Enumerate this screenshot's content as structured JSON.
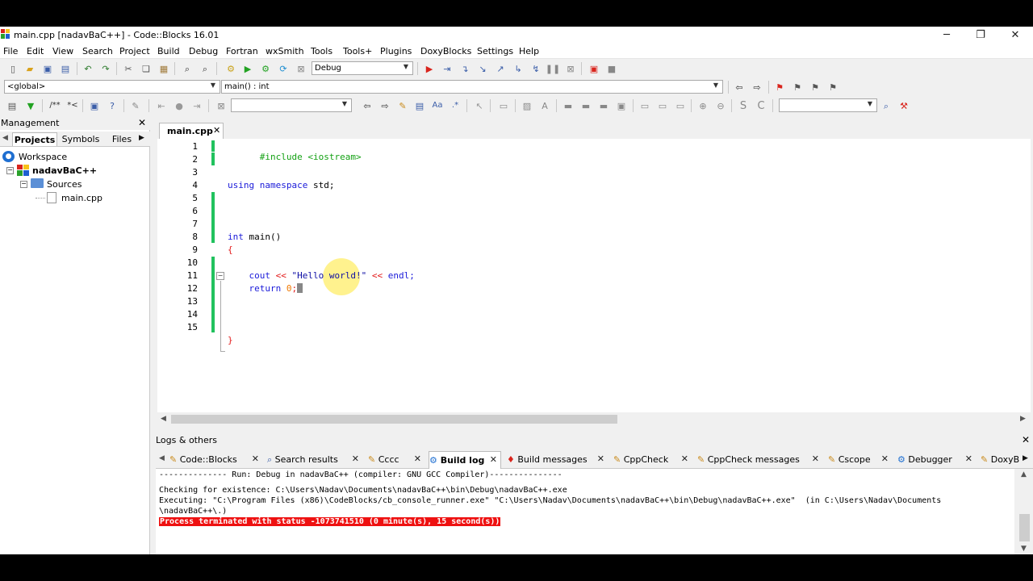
{
  "window": {
    "title": "main.cpp [nadavBaC++] - Code::Blocks 16.01",
    "minimize_glyph": "─",
    "restore_glyph": "❐",
    "close_glyph": "✕"
  },
  "menu": [
    "File",
    "Edit",
    "View",
    "Search",
    "Project",
    "Build",
    "Debug",
    "Fortran",
    "wxSmith",
    "Tools",
    "Tools+",
    "Plugins",
    "DoxyBlocks",
    "Settings",
    "Help"
  ],
  "toolbar": {
    "build_target": "Debug",
    "scope": "<global>",
    "function": "main() : int",
    "search_value": "",
    "find_value": ""
  },
  "management": {
    "title": "Management",
    "tabs": [
      "Projects",
      "Symbols",
      "Files"
    ],
    "active_tab": "Projects",
    "tree": {
      "workspace": "Workspace",
      "project": "nadavBaC++",
      "folder": "Sources",
      "file": "main.cpp"
    }
  },
  "editor": {
    "tab_label": "main.cpp",
    "line_numbers": [
      "1",
      "2",
      "3",
      "4",
      "5",
      "6",
      "7",
      "8",
      "9",
      "10",
      "11",
      "12",
      "13",
      "14",
      "15"
    ],
    "lines": {
      "l1": "#include <iostream>",
      "l4_kw": "using namespace",
      "l4_rest": " std;",
      "l8_kw": "int",
      "l8_rest": " main()",
      "l9": "{",
      "l11_a": "    cout ",
      "l11_op1": "<<",
      "l11_str": " \"Hello world!\" ",
      "l11_op2": "<<",
      "l11_b": " endl;",
      "l12_kw": "    return",
      "l12_num": " 0",
      "l12_b": ";",
      "l14": "}"
    }
  },
  "logs": {
    "title": "Logs & others",
    "tabs": [
      "Code::Blocks",
      "Search results",
      "Cccc",
      "Build log",
      "Build messages",
      "CppCheck",
      "CppCheck messages",
      "Cscope",
      "Debugger",
      "DoxyB"
    ],
    "active_tab": "Build log",
    "lines": [
      "-------------- Run: Debug in nadavBaC++ (compiler: GNU GCC Compiler)---------------",
      "Checking for existence: C:\\Users\\Nadav\\Documents\\nadavBaC++\\bin\\Debug\\nadavBaC++.exe",
      "Executing: \"C:\\Program Files (x86)\\CodeBlocks/cb_console_runner.exe\" \"C:\\Users\\Nadav\\Documents\\nadavBaC++\\bin\\Debug\\nadavBaC++.exe\"  (in C:\\Users\\Nadav\\Documents",
      "\\nadavBaC++\\.)"
    ],
    "status_line": "Process terminated with status -1073741510 (0 minute(s), 15 second(s))"
  },
  "colors": {
    "status_error_bg": "#ee1111",
    "change_bar": "#21c25e",
    "cursor_highlight": "#fff07a"
  }
}
